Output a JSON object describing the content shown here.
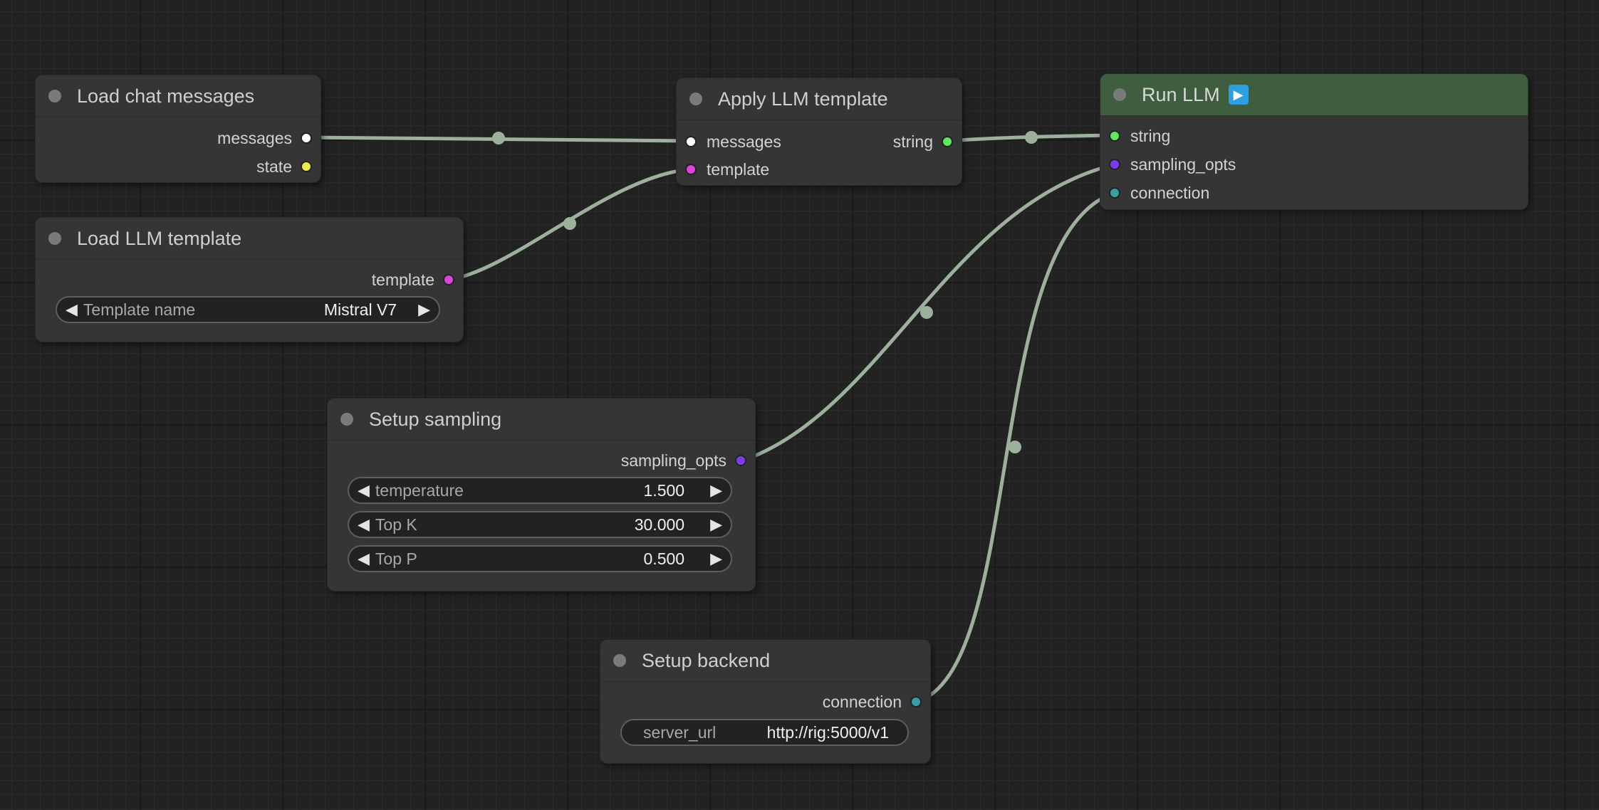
{
  "colors": {
    "background": "#222222",
    "node_body": "#353535",
    "run_header": "#3f5e3f",
    "link": "#9cb09c",
    "type_messages": "#ffffff",
    "type_state": "#e8e84a",
    "type_template": "#dd44dd",
    "type_string": "#5ee85e",
    "type_sampling_opts": "#7a3cf0",
    "type_connection": "#3a9ea5"
  },
  "nodes": {
    "load_chat": {
      "title": "Load chat messages",
      "outputs": [
        "messages",
        "state"
      ]
    },
    "load_template": {
      "title": "Load LLM template",
      "outputs": [
        "template"
      ],
      "widget": {
        "label": "Template name",
        "value": "Mistral V7"
      }
    },
    "apply_template": {
      "title": "Apply LLM template",
      "inputs": [
        "messages",
        "template"
      ],
      "outputs": [
        "string"
      ]
    },
    "run_llm": {
      "title": "Run LLM",
      "run_icon": "play-icon",
      "inputs": [
        "string",
        "sampling_opts",
        "connection"
      ]
    },
    "setup_sampling": {
      "title": "Setup sampling",
      "outputs": [
        "sampling_opts"
      ],
      "widgets": [
        {
          "label": "temperature",
          "value": "1.500"
        },
        {
          "label": "Top K",
          "value": "30.000"
        },
        {
          "label": "Top P",
          "value": "0.500"
        }
      ]
    },
    "setup_backend": {
      "title": "Setup backend",
      "outputs": [
        "connection"
      ],
      "widget": {
        "label": "server_url",
        "value": "http://rig:5000/v1"
      }
    }
  }
}
